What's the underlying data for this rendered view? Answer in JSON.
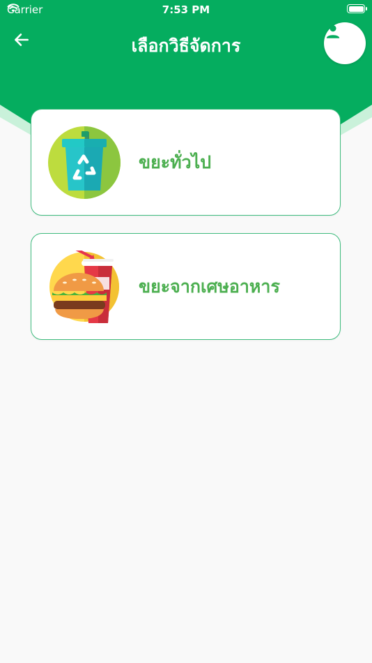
{
  "status_bar": {
    "carrier": "Carrier",
    "time": "7:53 PM",
    "battery_level": 1.0
  },
  "header": {
    "title": "เลือกวิธีจัดการ",
    "back_icon": "arrow-left-icon",
    "profile_icon": "person-icon"
  },
  "colors": {
    "primary": "#05ad5f",
    "accent_light": "#c9f1da",
    "card_border": "#3dbb7d",
    "label": "#4caf50",
    "background": "#f9f9f9"
  },
  "options": [
    {
      "label": "ขยะทั่วไป",
      "icon": "recycle-bin-icon"
    },
    {
      "label": "ขยะจากเศษอาหาร",
      "icon": "food-waste-icon"
    }
  ]
}
